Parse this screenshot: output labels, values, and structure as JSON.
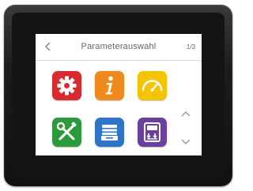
{
  "header": {
    "title": "Parameterauswahl",
    "page_indicator": "1/3",
    "back_icon": "chevron-left-icon"
  },
  "tiles": [
    {
      "icon": "settings-gear-icon",
      "color": "#d92b2f"
    },
    {
      "icon": "info-icon",
      "color": "#f18a1c"
    },
    {
      "icon": "gauge-icon",
      "color": "#f5c400"
    },
    {
      "icon": "tools-icon",
      "color": "#2a9a3a"
    },
    {
      "icon": "archive-box-icon",
      "color": "#2e74c8"
    },
    {
      "icon": "download-panel-icon",
      "color": "#6a3fa0"
    }
  ],
  "scroll": {
    "up_icon": "chevron-up-icon",
    "down_icon": "chevron-down-icon"
  }
}
